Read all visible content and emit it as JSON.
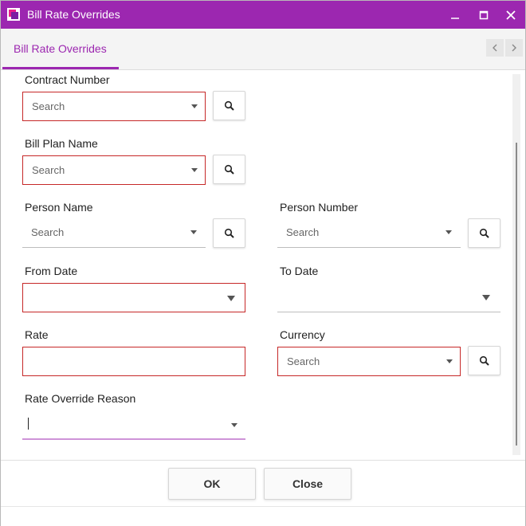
{
  "window": {
    "title": "Bill Rate Overrides"
  },
  "tabs": [
    {
      "label": "Bill Rate Overrides"
    }
  ],
  "fields": {
    "contract_number": {
      "label": "Contract Number",
      "placeholder": "Search"
    },
    "bill_plan_name": {
      "label": "Bill Plan Name",
      "placeholder": "Search"
    },
    "person_name": {
      "label": "Person Name",
      "placeholder": "Search"
    },
    "person_number": {
      "label": "Person Number",
      "placeholder": "Search"
    },
    "from_date": {
      "label": "From Date",
      "value": ""
    },
    "to_date": {
      "label": "To Date",
      "value": ""
    },
    "rate": {
      "label": "Rate",
      "value": ""
    },
    "currency": {
      "label": "Currency",
      "placeholder": "Search"
    },
    "rate_override_reason": {
      "label": "Rate Override Reason",
      "value": ""
    }
  },
  "footer": {
    "ok_label": "OK",
    "close_label": "Close"
  },
  "colors": {
    "accent": "#9c27b0",
    "required_border": "#c62828"
  },
  "icons": [
    "app-icon",
    "minimize-icon",
    "maximize-icon",
    "close-icon",
    "chevron-left-icon",
    "chevron-right-icon",
    "search-icon",
    "dropdown-caret-icon"
  ]
}
